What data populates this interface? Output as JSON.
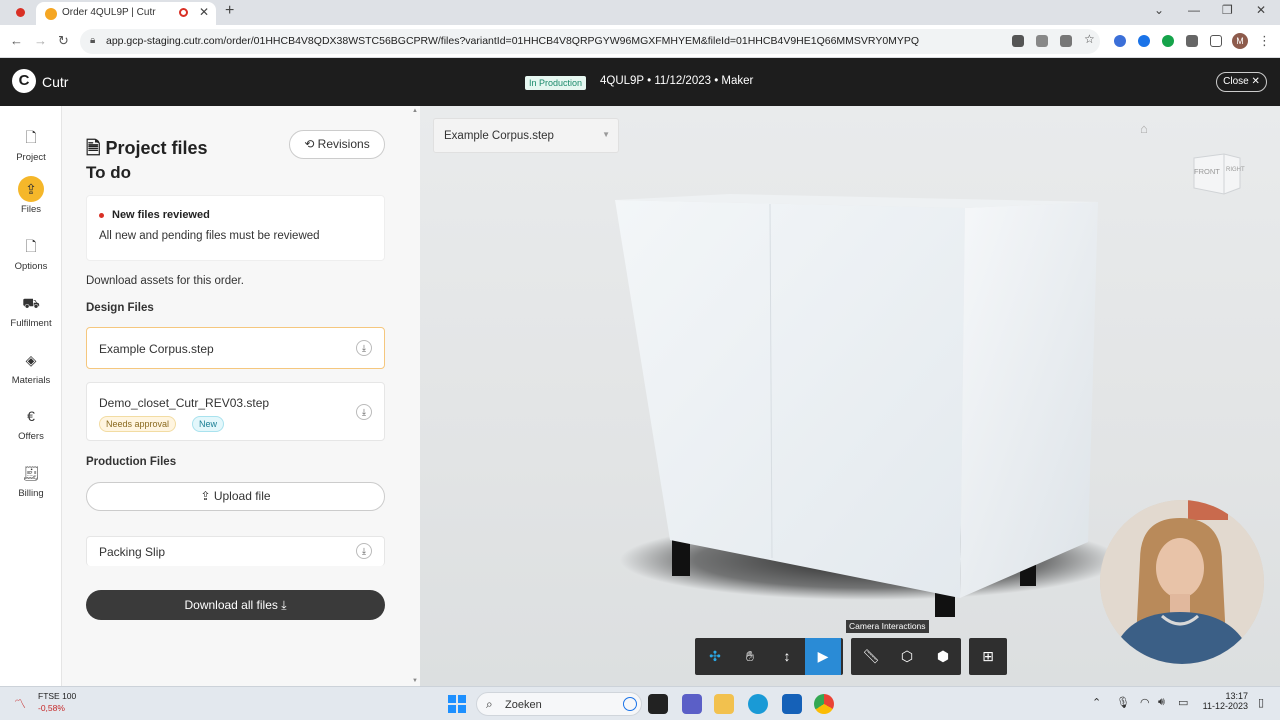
{
  "browser": {
    "tab_title": "Order 4QUL9P | Cutr",
    "url": "app.gcp-staging.cutr.com/order/01HHCB4V8QDX38WSTC56BGCPRW/files?variantId=01HHCB4V8QRPGYW96MGXFMHYEM&fileId=01HHCB4V9HE1Q66MMSVRY0MYPQ",
    "profile_initial": "M"
  },
  "app": {
    "brand": "Cutr",
    "status": "In Production",
    "order_info": "4QUL9P • 11/12/2023 • Maker",
    "close_label": "Close"
  },
  "rail": {
    "project": "Project",
    "files": "Files",
    "options": "Options",
    "fulfilment": "Fulfilment",
    "materials": "Materials",
    "offers": "Offers",
    "billing": "Billing"
  },
  "files": {
    "title": "Project files",
    "subtitle": "To do",
    "revisions_label": "Revisions",
    "notice_title": "New files reviewed",
    "notice_text": "All new and pending files must be reviewed",
    "download_text": "Download assets for this order.",
    "design_heading": "Design Files",
    "design": [
      {
        "name": "Example Corpus.step"
      },
      {
        "name": "Demo_closet_Cutr_REV03.step",
        "badge_approval": "Needs approval",
        "badge_new": "New"
      }
    ],
    "production_heading": "Production Files",
    "upload_label": "Upload file",
    "packing_slip": "Packing Slip",
    "download_all_label": "Download all files"
  },
  "viewer": {
    "selected_file": "Example Corpus.step",
    "cube_front": "FRONT",
    "cube_right": "RIGHT",
    "tooltip": "Camera Interactions"
  },
  "taskbar": {
    "ticker_name": "FTSE 100",
    "ticker_change": "-0,58%",
    "search_placeholder": "Zoeken",
    "time": "13:17",
    "date": "11-12-2023"
  }
}
